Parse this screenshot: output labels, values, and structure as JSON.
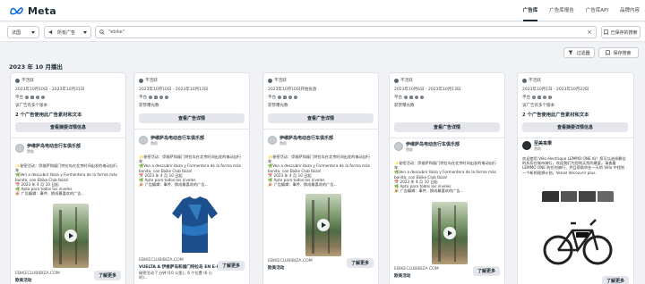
{
  "brand": {
    "logo_text": "Meta"
  },
  "nav": [
    "广告库",
    "广告库报告",
    "广告库API",
    "品牌内容"
  ],
  "filters": {
    "region": "法国",
    "ad_type": "所有广告",
    "search_value": "\"ebike\"",
    "saved_searches": "已保存的搜索"
  },
  "actions": {
    "filters": "过滤器",
    "save_search": "保存搜索"
  },
  "month_heading": "2023 年 10 月播出",
  "cards": [
    {
      "status": "不活跃",
      "date": "2023年10月10日 - 2023年10月21日",
      "platforms_label": "平台",
      "disclaimer": "该广告有多个版本",
      "multi_ads": "2 个广告使用此广告素材和文本",
      "detail_button": "查看摘要详情信息",
      "advertiser": "伊维萨岛电动自行车俱乐部",
      "sponsored": "赞助",
      "body": [
        "✨秘密活动：伊维萨和福门特拉岛在北京时间出发的电动自行车",
        "🌿Ven a descubrir Ibiza y Formentera de la forma más bonita, con Ebike Club Ibiza!",
        "📅 2023 年 4 月 10 日起",
        "🌿 Apto para todos los niveles",
        "🎉 广告编辑：事件、换成最喜欢的广告..."
      ],
      "url": "EBIKECLUBIBIZA.COM",
      "cta_title": "欧美活动",
      "learn_more": "了解更多"
    },
    {
      "status": "不活跃",
      "date": "2023年10月10日 - 2023年10月13日",
      "platforms_label": "平台",
      "disclaimer": "获赞曝光数",
      "detail_button": "查看广告详情",
      "advertiser": "伊维萨岛电动自行车俱乐部",
      "sponsored": "赞助",
      "body": [
        "✨秘密活动：伊维萨和福门特拉岛在北京时间出发的电动自行车",
        "🌿Ven a descubrir Ibiza y Formentera de la forma más bonita, con Ebike Club Ibiza!",
        "📅 2023 年 4 月 10 日起",
        "🌿 Apto para todos los niveles",
        "🎉 广告编辑：事件、换成最喜欢的广告..."
      ],
      "url": "EBIKECLUBIBIZA.COM",
      "cta_title": "VUELTA A 伊维萨岛和福门特拉岛 EN E-MTB",
      "cta_desc": "秘密活动 7 分钟 (10 公里)，6 个位置 (6 小时)...",
      "learn_more": "了解更多"
    },
    {
      "status": "不活跃",
      "date": "2023年10月10日开始投放",
      "platforms_label": "平台",
      "disclaimer": "获赞曝光数",
      "detail_button": "查看广告详情",
      "advertiser": "伊维萨岛电动自行车俱乐部",
      "sponsored": "赞助",
      "body": [
        "✨秘密活动：伊维萨和福门特拉岛在北京时间出发的电动自行车",
        "🌿Ven a descubrir Ibiza y Formentera de la forma más bonita, con Ebike Club Ibiza!",
        "📅 2023 年 4 月 10 日起",
        "🌿 Apto para todos los niveles",
        "🎉 广告编辑：事件、换成最喜欢的广告..."
      ],
      "url": "EBIKECLUBIBIZA.COM",
      "cta_title": "欧美活动",
      "learn_more": "了解更多"
    },
    {
      "status": "不活跃",
      "date": "2023年10月6日 - 2023年10月13日",
      "platforms_label": "平台",
      "disclaimer": "获赞曝光数",
      "detail_button": "查看广告详情",
      "advertiser": "伊维萨岛电动自行车俱乐部",
      "sponsored": "赞助",
      "body": [
        "✨秘密活动：伊维萨和福门特拉岛在北京时间出发的电动自行车",
        "🌿Ven a descubrir Ibiza y Formentera de la forma más bonita, con Ebike Club Ibiza!",
        "📅 2023 年 4 月 10 日起",
        "🌿 Apto para todos los niveles",
        "🎉 广告编辑：事件、换成最喜欢的广告..."
      ],
      "url": "EBIKECLUBIBIZA.COM",
      "cta_title": "欧美活动",
      "learn_more": "了解更多"
    },
    {
      "status": "不活跃",
      "date": "2023年10月1日 - 2023年10月22日",
      "platforms_label": "平台",
      "disclaimer": "该广告有多个版本",
      "multi_ads": "2 个广告使用此广告素材和文本",
      "detail_button": "查看摘要详情信息",
      "advertiser": "至美来秉",
      "sponsored": "赞助",
      "body": [
        "欢迎使用 Vélo électrique LEMMO ONE 吗？您可以选择最佳的折扣在城市骑行，欢迎我们为您购买您的最爱。请查看 LEMMO ONE 的任何骑行，并且帮助你在一天的 Vélo 中找到一个新的理想计划。Venez découvrir plus."
      ],
      "learn_more": "了解更多"
    }
  ]
}
